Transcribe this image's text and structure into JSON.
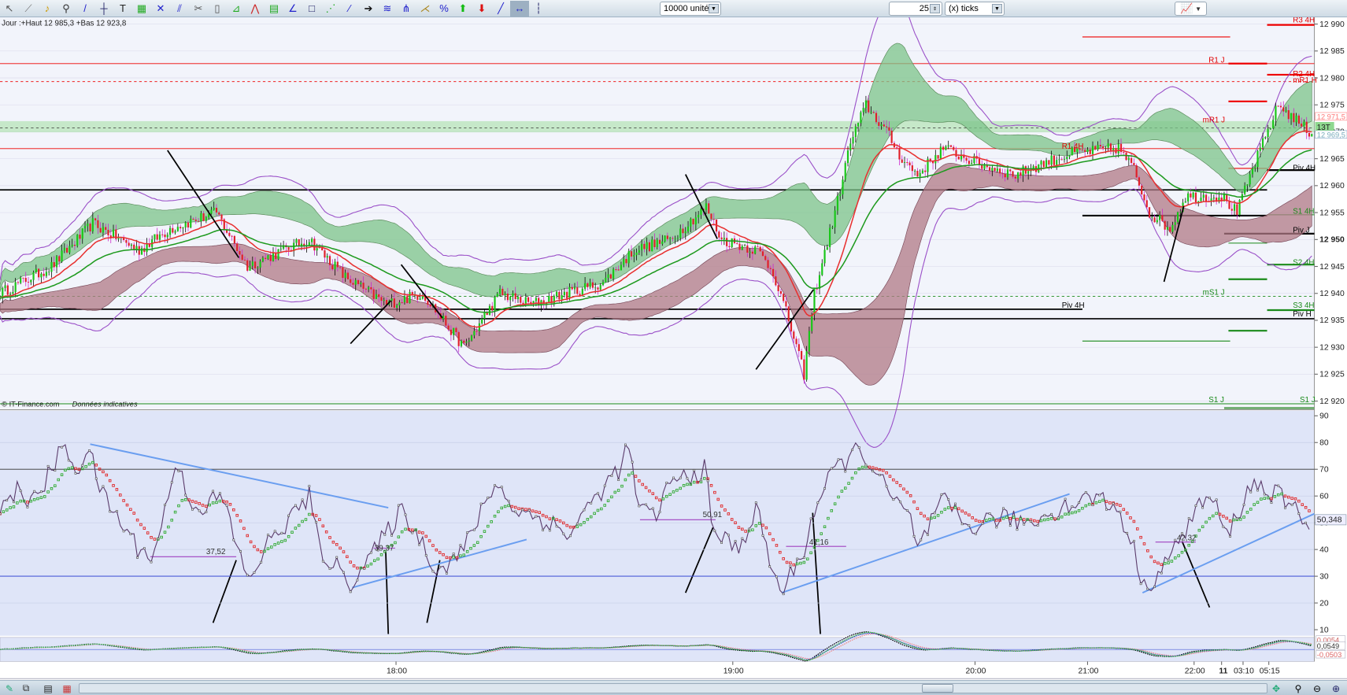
{
  "toolbar": {
    "icons": [
      "pointer-icon",
      "ruler-icon",
      "alert-bell-icon",
      "zoom-icon",
      "trendline-icon",
      "horizontal-line-icon",
      "text-icon",
      "fibonacci-icon",
      "cross-lines-icon",
      "parallel-lines-icon",
      "tools-icon",
      "trash-icon",
      "fibo-retracement-icon",
      "fan-icon",
      "channel-icon",
      "angle-icon",
      "rectangle-icon",
      "gann-fan-icon",
      "gann-angle-icon",
      "arrow-right-icon",
      "regression-icon",
      "pitchfork-icon",
      "speed-lines-icon",
      "percent-icon",
      "buy-arrow-icon",
      "sell-arrow-icon",
      "line-icon",
      "measure-icon",
      "vertical-line-icon"
    ],
    "glyphs": [
      "↖",
      "⟋",
      "♪",
      "⚲",
      "/",
      "┼",
      "T",
      "▦",
      "✕",
      "⫽",
      "✂",
      "▯",
      "⊿",
      "⋀",
      "▤",
      "∠",
      "□",
      "⋰",
      "⁄",
      "➔",
      "≋",
      "⋔",
      "⋌",
      "%",
      "⬆",
      "⬇",
      "╱",
      "↔",
      "┆"
    ],
    "units_value": "10000 unités",
    "ticks_value": "25",
    "ticks_unit": "(x) ticks"
  },
  "header": {
    "info": "Jour :+Haut 12 985,3 +Bas 12 923,8",
    "watermark": "© IT-Finance.com",
    "watermark_note": "Données indicatives"
  },
  "price_axis": {
    "ticks": [
      "12 990",
      "12 985",
      "12 980",
      "12 975",
      "12 970",
      "12 965",
      "12 960",
      "12 955",
      "12 950",
      "12 945",
      "12 940",
      "12 935",
      "12 930",
      "12 925",
      "12 920"
    ],
    "last_high": "12 971,5",
    "last_low": "12 969,5",
    "badge": "13T"
  },
  "levels": [
    {
      "label": "R3 4H",
      "price": 12990,
      "color": "#e00000"
    },
    {
      "label": "R1 J",
      "price": 12982.5,
      "color": "#e00000"
    },
    {
      "label": "R2 4H",
      "price": 12980,
      "color": "#e00000"
    },
    {
      "label": "mR1 H",
      "price": 12978.8,
      "color": "#e00000"
    },
    {
      "label": "mR1 J",
      "price": 12971.4,
      "color": "#e00000"
    },
    {
      "label": "R1 4H",
      "price": 12966.5,
      "color": "#e00000"
    },
    {
      "label": "Piv 4H",
      "price": 12962.5,
      "color": "#000000"
    },
    {
      "label": "S1 4H",
      "price": 12954.5,
      "color": "#1a8a1a"
    },
    {
      "label": "Piv J",
      "price": 12951,
      "color": "#000000"
    },
    {
      "label": "S2 4H",
      "price": 12945,
      "color": "#1a8a1a"
    },
    {
      "label": "mS1 J",
      "price": 12939.4,
      "color": "#1a8a1a"
    },
    {
      "label": "S3 4H",
      "price": 12937,
      "color": "#1a8a1a"
    },
    {
      "label": "Piv H",
      "price": 12935.4,
      "color": "#000000"
    },
    {
      "label": "Piv 4H",
      "price": 12937,
      "color": "#000000"
    },
    {
      "label": "S1 J",
      "price": 12919.5,
      "color": "#1a8a1a"
    }
  ],
  "rsi_axis": {
    "ticks": [
      "90",
      "80",
      "70",
      "60",
      "50",
      "40",
      "30",
      "20",
      "10"
    ],
    "current": "50,348"
  },
  "rsi_labels": [
    "37,52",
    "39,37",
    "50,91",
    "41,16",
    "42,32"
  ],
  "macd_axis": {
    "values": [
      "0,0054",
      "0,0549",
      "-0,0503"
    ]
  },
  "time_axis": {
    "labels": [
      "18:00",
      "19:00",
      "20:00",
      "21:00",
      "22:00",
      "11",
      "03:10",
      "05:15"
    ]
  },
  "bottom": {
    "icons": [
      "edit-chart-icon",
      "candles-icon",
      "list-icon",
      "grid-icon"
    ],
    "right_icons": [
      "bar-spacing-icon",
      "zoom-auto-icon",
      "zoom-out-icon",
      "zoom-in-icon"
    ]
  },
  "colors": {
    "up": "#19c619",
    "down": "#e0202a",
    "wick": "#cc22cc",
    "boll": "#9a4fc8",
    "ema_fast": "#e83030",
    "ema_slow": "#1e9a1e",
    "cloud_up": "#7cc48a",
    "cloud_dn": "#b07a86",
    "trend": "#6a9ef0"
  },
  "chart_data": {
    "type": "line",
    "title": "Intraday price with Bollinger bands, RSI and MACD",
    "price_keypoints": [
      [
        0,
        12940
      ],
      [
        10,
        12945
      ],
      [
        18,
        12953
      ],
      [
        27,
        12948
      ],
      [
        33,
        12952
      ],
      [
        42,
        12955
      ],
      [
        48,
        12945
      ],
      [
        55,
        12948
      ],
      [
        60,
        12950
      ],
      [
        67,
        12943
      ],
      [
        75,
        12938
      ],
      [
        82,
        12940
      ],
      [
        90,
        12930
      ],
      [
        97,
        12940
      ],
      [
        103,
        12938
      ],
      [
        110,
        12940
      ],
      [
        117,
        12942
      ],
      [
        123,
        12948
      ],
      [
        130,
        12950
      ],
      [
        137,
        12956
      ],
      [
        140,
        12950
      ],
      [
        147,
        12948
      ],
      [
        150,
        12944
      ],
      [
        153,
        12935
      ],
      [
        156,
        12925
      ],
      [
        158,
        12940
      ],
      [
        162,
        12955
      ],
      [
        165,
        12968
      ],
      [
        168,
        12975
      ],
      [
        172,
        12970
      ],
      [
        175,
        12965
      ],
      [
        178,
        12962
      ],
      [
        183,
        12967
      ],
      [
        190,
        12964
      ],
      [
        197,
        12962
      ],
      [
        202,
        12964
      ],
      [
        208,
        12966
      ],
      [
        217,
        12967
      ],
      [
        220,
        12963
      ],
      [
        223,
        12955
      ],
      [
        227,
        12952
      ],
      [
        230,
        12958
      ],
      [
        237,
        12958
      ],
      [
        240,
        12955
      ],
      [
        243,
        12963
      ],
      [
        248,
        12975
      ],
      [
        254,
        12970
      ]
    ],
    "rsi_keypoints": [
      [
        0,
        55
      ],
      [
        3,
        62
      ],
      [
        7,
        58
      ],
      [
        12,
        78
      ],
      [
        15,
        70
      ],
      [
        17,
        78
      ],
      [
        20,
        60
      ],
      [
        27,
        40
      ],
      [
        30,
        38
      ],
      [
        34,
        72
      ],
      [
        38,
        55
      ],
      [
        43,
        60
      ],
      [
        47,
        35
      ],
      [
        48,
        28
      ],
      [
        52,
        42
      ],
      [
        60,
        60
      ],
      [
        62,
        40
      ],
      [
        68,
        28
      ],
      [
        73,
        40
      ],
      [
        78,
        55
      ],
      [
        82,
        42
      ],
      [
        85,
        32
      ],
      [
        90,
        40
      ],
      [
        96,
        65
      ],
      [
        100,
        55
      ],
      [
        107,
        50
      ],
      [
        110,
        45
      ],
      [
        115,
        58
      ],
      [
        120,
        70
      ],
      [
        122,
        78
      ],
      [
        124,
        55
      ],
      [
        127,
        52
      ],
      [
        130,
        65
      ],
      [
        137,
        70
      ],
      [
        138,
        48
      ],
      [
        143,
        40
      ],
      [
        147,
        55
      ],
      [
        150,
        30
      ],
      [
        152,
        25
      ],
      [
        156,
        40
      ],
      [
        158,
        55
      ],
      [
        162,
        70
      ],
      [
        167,
        78
      ],
      [
        172,
        62
      ],
      [
        177,
        50
      ],
      [
        178,
        40
      ],
      [
        183,
        58
      ],
      [
        188,
        48
      ],
      [
        193,
        52
      ],
      [
        200,
        50
      ],
      [
        205,
        55
      ],
      [
        212,
        60
      ],
      [
        217,
        55
      ],
      [
        220,
        40
      ],
      [
        222,
        25
      ],
      [
        228,
        40
      ],
      [
        232,
        55
      ],
      [
        235,
        60
      ],
      [
        238,
        45
      ],
      [
        243,
        65
      ],
      [
        248,
        60
      ],
      [
        254,
        50
      ]
    ],
    "rsi_ylim": [
      10,
      90
    ],
    "price_ylim": [
      12920,
      12990
    ]
  }
}
